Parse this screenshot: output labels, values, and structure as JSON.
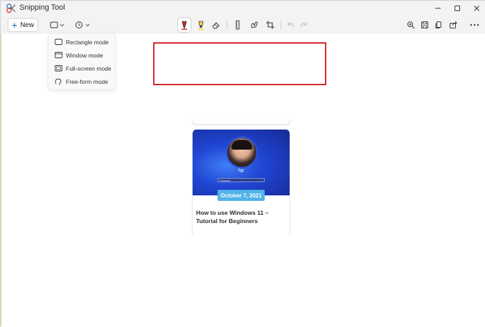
{
  "window": {
    "title": "Snipping Tool",
    "controls": [
      "minimize",
      "maximize",
      "close"
    ]
  },
  "toolbar": {
    "new_label": "New",
    "snip_mode_icon": "rectangle-snip-icon",
    "delay_icon": "clock-icon",
    "markup_tools": [
      {
        "name": "ballpoint-pen",
        "icon": "pen-icon",
        "active": true
      },
      {
        "name": "highlighter",
        "icon": "highlighter-icon",
        "active": false
      },
      {
        "name": "eraser",
        "icon": "eraser-icon",
        "active": false
      },
      {
        "name": "ruler",
        "icon": "ruler-icon",
        "active": false
      },
      {
        "name": "touch-writing",
        "icon": "touch-writing-icon",
        "active": false
      },
      {
        "name": "crop",
        "icon": "crop-icon",
        "active": false
      },
      {
        "name": "undo",
        "icon": "undo-icon",
        "active": false
      },
      {
        "name": "redo",
        "icon": "redo-icon",
        "active": false
      }
    ],
    "right_tools": [
      {
        "name": "zoom",
        "icon": "zoom-icon"
      },
      {
        "name": "save",
        "icon": "save-icon"
      },
      {
        "name": "copy",
        "icon": "copy-icon"
      },
      {
        "name": "share",
        "icon": "share-icon"
      },
      {
        "name": "more",
        "icon": "more-icon"
      }
    ]
  },
  "snip_menu": {
    "items": [
      {
        "label": "Rectangle mode",
        "icon": "rectangle-mode-icon"
      },
      {
        "label": "Window mode",
        "icon": "window-mode-icon"
      },
      {
        "label": "Full-screen mode",
        "icon": "fullscreen-mode-icon"
      },
      {
        "label": "Free-form mode",
        "icon": "freeform-mode-icon"
      }
    ]
  },
  "card": {
    "login_name": "hp",
    "password_placeholder": "Password",
    "date": "October 7, 2021",
    "title": "How to use Windows 11 – Tutorial for Beginners"
  },
  "colors": {
    "accent": "#1a5fb4",
    "highlight_border": "#d4262c",
    "badge": "#4fb3e8",
    "image_blue": "#2046d4"
  }
}
